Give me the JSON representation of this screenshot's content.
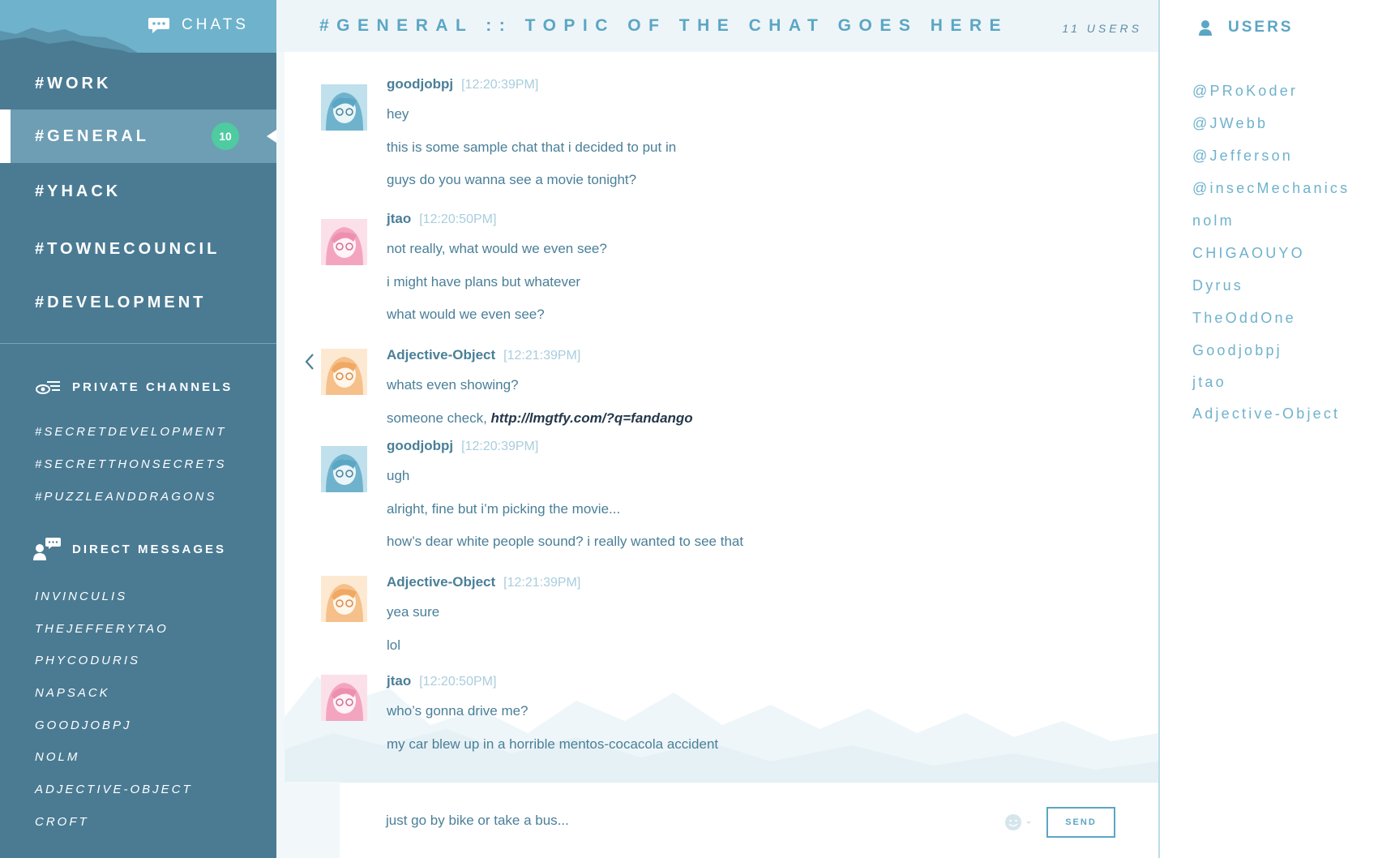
{
  "sidebar": {
    "title": "CHATS",
    "channels": [
      {
        "label": "#WORK",
        "active": false
      },
      {
        "label": "#GENERAL",
        "active": true,
        "badge": "10"
      },
      {
        "label": "#YHACK",
        "active": false
      },
      {
        "label": "#TOWNECOUNCIL",
        "active": false
      },
      {
        "label": "#DEVELOPMENT",
        "active": false
      }
    ],
    "private_title": "PRIVATE CHANNELS",
    "private_channels": [
      "#SECRETDEVELOPMENT",
      "#SECRETTHONSECRETS",
      "#PUZZLEANDDRAGONS"
    ],
    "dm_title": "DIRECT MESSAGES",
    "direct_messages": [
      "INVINCULIS",
      "THEJEFFERYTAO",
      "PHYCODURIS",
      "NAPSACK",
      "GOODJOBPJ",
      "NOLM",
      "ADJECTIVE-OBJECT",
      "CROFT"
    ]
  },
  "header": {
    "topic": "#GENERAL :: TOPIC OF THE CHAT GOES HERE",
    "user_count": "11 USERS"
  },
  "messages": [
    {
      "user": "goodjobpj",
      "time": "[12:20:39PM]",
      "avatar": "blue",
      "lines": [
        "hey",
        "this is some sample chat that i decided to put in",
        "guys do you wanna see a movie tonight?"
      ]
    },
    {
      "user": "jtao",
      "time": "[12:20:50PM]",
      "avatar": "pink",
      "lines": [
        "not really, what would we even see?",
        "i might have plans but whatever",
        "what would we even see?"
      ]
    },
    {
      "user": "Adjective-Object",
      "time": "[12:21:39PM]",
      "avatar": "orange",
      "lines": [
        "whats even showing?"
      ],
      "link_line": {
        "prefix": "someone check, ",
        "link": "http://lmgtfy.com/?q=fandango"
      }
    },
    {
      "user": "goodjobpj",
      "time": "[12:20:39PM]",
      "avatar": "blue",
      "lines": [
        "ugh",
        "alright, fine but i’m picking the movie...",
        "how’s dear white people sound? i really wanted to see that"
      ]
    },
    {
      "user": "Adjective-Object",
      "time": "[12:21:39PM]",
      "avatar": "orange",
      "lines": [
        "yea sure",
        "lol"
      ]
    },
    {
      "user": "jtao",
      "time": "[12:20:50PM]",
      "avatar": "pink",
      "lines": [
        "who’s gonna drive me?",
        "my car blew up in a horrible mentos-cocacola accident"
      ]
    }
  ],
  "composer": {
    "value": "just go by bike or take a bus...",
    "send_label": "SEND"
  },
  "users_panel": {
    "title": "USERS",
    "users": [
      "@PRoKoder",
      "@JWebb",
      "@Jefferson",
      "@insecMechanics",
      "nolm",
      "CHIGAOUYO",
      "Dyrus",
      "TheOddOne",
      "Goodjobpj",
      "jtao",
      "Adjective-Object"
    ]
  },
  "colors": {
    "sidebar_bg": "#4a7b93",
    "sidebar_header": "#6fb2cc",
    "accent": "#5ba6c4",
    "badge": "#4ecba0",
    "avatar_blue": "#6fb2cc",
    "avatar_pink": "#f3a5bf",
    "avatar_orange": "#f5c08a"
  }
}
